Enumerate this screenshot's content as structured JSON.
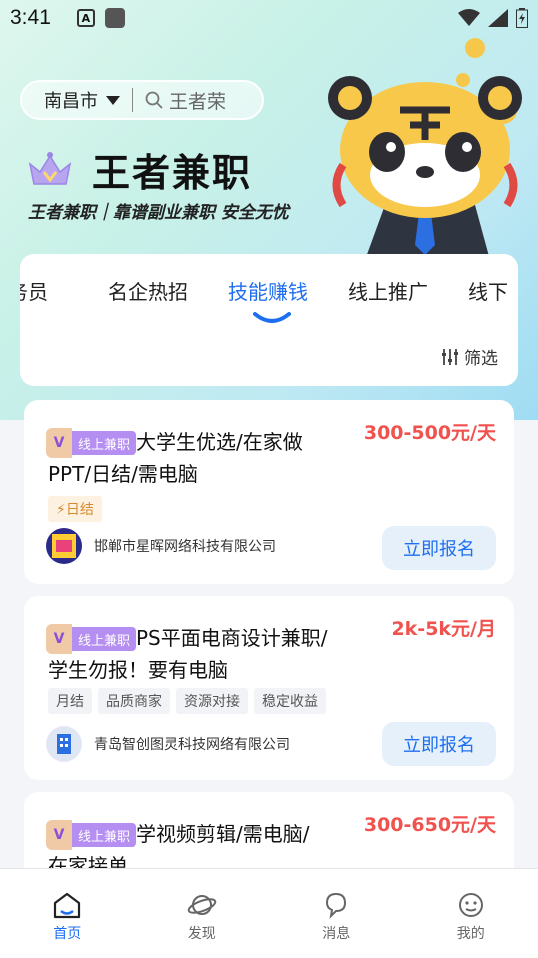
{
  "status": {
    "time": "3:41",
    "a_icon": "A"
  },
  "header": {
    "city": "南昌市",
    "search_placeholder": "王者荣",
    "brand_title": "王者兼职",
    "slogan": "王者兼职｜靠谱副业兼职 安全无忧"
  },
  "tabs": {
    "items": [
      {
        "label": "务员"
      },
      {
        "label": "名企热招"
      },
      {
        "label": "技能赚钱"
      },
      {
        "label": "线上推广"
      },
      {
        "label": "线下"
      }
    ],
    "active_index": 2,
    "filter_label": "筛选"
  },
  "jobs": [
    {
      "tag": "线上兼职",
      "title": "大学生优选/在家做PPT/日结/需电脑",
      "salary": "300-500元/天",
      "perks": [
        "日结"
      ],
      "company": "邯郸市星晖网络科技有限公司",
      "apply_label": "立即报名"
    },
    {
      "tag": "线上兼职",
      "title": "PS平面电商设计兼职/学生勿报！要有电脑",
      "salary": "2k-5k元/月",
      "perks": [
        "月结",
        "品质商家",
        "资源对接",
        "稳定收益"
      ],
      "company": "青岛智创图灵科技网络有限公司",
      "apply_label": "立即报名"
    },
    {
      "tag": "线上兼职",
      "title": "学视频剪辑/需电脑/在家接单",
      "salary": "300-650元/天"
    }
  ],
  "nav": [
    {
      "label": "首页",
      "icon": "home-icon"
    },
    {
      "label": "发现",
      "icon": "planet-icon"
    },
    {
      "label": "消息",
      "icon": "message-icon"
    },
    {
      "label": "我的",
      "icon": "face-icon"
    }
  ],
  "colors": {
    "accent": "#1e6ff0",
    "salary": "#f0524f",
    "tag": "#b48ef0"
  }
}
